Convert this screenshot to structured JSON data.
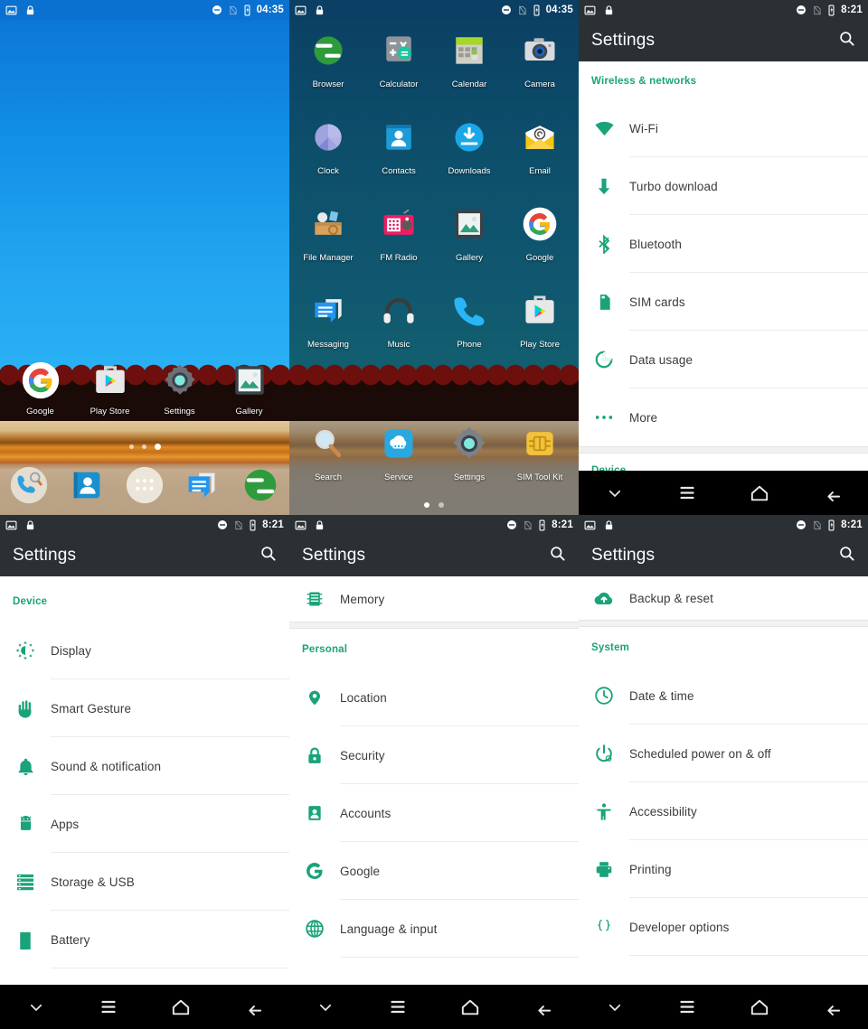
{
  "statusbar": {
    "time_home": "04:35",
    "time_settings": "8:21",
    "icons_left": [
      "screenshot-icon",
      "lock-icon"
    ],
    "icons_right": [
      "dnd-icon",
      "no-sim-icon",
      "battery-charging-icon"
    ]
  },
  "navbar": {
    "items": [
      {
        "name": "hide-keyboard-button",
        "glyph": "chevron-down-icon"
      },
      {
        "name": "recents-button",
        "glyph": "menu-icon"
      },
      {
        "name": "home-button",
        "glyph": "home-icon"
      },
      {
        "name": "back-button",
        "glyph": "back-arrow-icon"
      }
    ]
  },
  "colors": {
    "accent_green": "#1aa37a",
    "actionbar": "#2b3034",
    "navbar": "#000000",
    "statusbar_blue": "#0a71d0",
    "list_text": "#3b3b3b"
  },
  "home_screen": {
    "apps": [
      {
        "label": "Google",
        "icon": "google-g-icon"
      },
      {
        "label": "Play Store",
        "icon": "play-store-icon"
      },
      {
        "label": "Settings",
        "icon": "settings-gear-icon"
      },
      {
        "label": "Gallery",
        "icon": "gallery-icon"
      }
    ],
    "page_dots": {
      "count": 3,
      "active_index": 2
    },
    "dock": [
      {
        "label": "Phone",
        "icon": "phone-dialer-icon"
      },
      {
        "label": "Contacts",
        "icon": "contacts-icon"
      },
      {
        "label": "All apps",
        "icon": "app-drawer-icon"
      },
      {
        "label": "Messaging",
        "icon": "messaging-icon"
      },
      {
        "label": "Browser",
        "icon": "browser-icon"
      }
    ]
  },
  "app_drawer": {
    "apps": [
      {
        "label": "Browser",
        "icon": "browser-icon"
      },
      {
        "label": "Calculator",
        "icon": "calculator-icon"
      },
      {
        "label": "Calendar",
        "icon": "calendar-icon"
      },
      {
        "label": "Camera",
        "icon": "camera-icon"
      },
      {
        "label": "Clock",
        "icon": "clock-icon"
      },
      {
        "label": "Contacts",
        "icon": "contacts-icon"
      },
      {
        "label": "Downloads",
        "icon": "downloads-icon"
      },
      {
        "label": "Email",
        "icon": "email-icon"
      },
      {
        "label": "File Manager",
        "icon": "file-manager-icon"
      },
      {
        "label": "FM Radio",
        "icon": "fm-radio-icon"
      },
      {
        "label": "Gallery",
        "icon": "gallery-icon"
      },
      {
        "label": "Google",
        "icon": "google-g-icon"
      },
      {
        "label": "Messaging",
        "icon": "messaging-icon"
      },
      {
        "label": "Music",
        "icon": "music-headphones-icon"
      },
      {
        "label": "Phone",
        "icon": "phone-icon"
      },
      {
        "label": "Play Store",
        "icon": "play-store-icon"
      }
    ],
    "apps_row2": [
      {
        "label": "Search",
        "icon": "magnifier-icon"
      },
      {
        "label": "Service",
        "icon": "service-cloud-icon"
      },
      {
        "label": "Settings",
        "icon": "settings-gear-icon"
      },
      {
        "label": "SIM Tool Kit",
        "icon": "sim-chip-icon"
      }
    ],
    "page_dots": {
      "count": 2,
      "active_index": 0
    }
  },
  "settings": {
    "title": "Settings",
    "search_label": "Search",
    "panel_wireless": {
      "section": "Wireless & networks",
      "items": [
        {
          "label": "Wi-Fi",
          "icon": "wifi-icon"
        },
        {
          "label": "Turbo download",
          "icon": "download-arrow-icon"
        },
        {
          "label": "Bluetooth",
          "icon": "bluetooth-icon"
        },
        {
          "label": "SIM cards",
          "icon": "sim-card-icon"
        },
        {
          "label": "Data usage",
          "icon": "data-usage-icon"
        },
        {
          "label": "More",
          "icon": "more-dots-icon"
        }
      ],
      "next_section": "Device"
    },
    "panel_device": {
      "section": "Device",
      "items": [
        {
          "label": "Display",
          "icon": "brightness-icon"
        },
        {
          "label": "Smart Gesture",
          "icon": "hand-icon"
        },
        {
          "label": "Sound & notification",
          "icon": "bell-icon"
        },
        {
          "label": "Apps",
          "icon": "android-icon"
        },
        {
          "label": "Storage & USB",
          "icon": "storage-list-icon"
        },
        {
          "label": "Battery",
          "icon": "battery-icon"
        }
      ]
    },
    "panel_personal": {
      "top_item": {
        "label": "Memory",
        "icon": "memory-icon"
      },
      "section": "Personal",
      "items": [
        {
          "label": "Location",
          "icon": "location-pin-icon"
        },
        {
          "label": "Security",
          "icon": "lock-icon"
        },
        {
          "label": "Accounts",
          "icon": "account-icon"
        },
        {
          "label": "Google",
          "icon": "google-g-icon"
        },
        {
          "label": "Language & input",
          "icon": "globe-icon"
        }
      ]
    },
    "panel_system": {
      "top_item": {
        "label": "Backup & reset",
        "icon": "cloud-upload-icon"
      },
      "section": "System",
      "items": [
        {
          "label": "Date & time",
          "icon": "clock-icon"
        },
        {
          "label": "Scheduled power on & off",
          "icon": "power-icon"
        },
        {
          "label": "Accessibility",
          "icon": "accessibility-icon"
        },
        {
          "label": "Printing",
          "icon": "printer-icon"
        },
        {
          "label": "Developer options",
          "icon": "braces-icon"
        }
      ]
    }
  }
}
